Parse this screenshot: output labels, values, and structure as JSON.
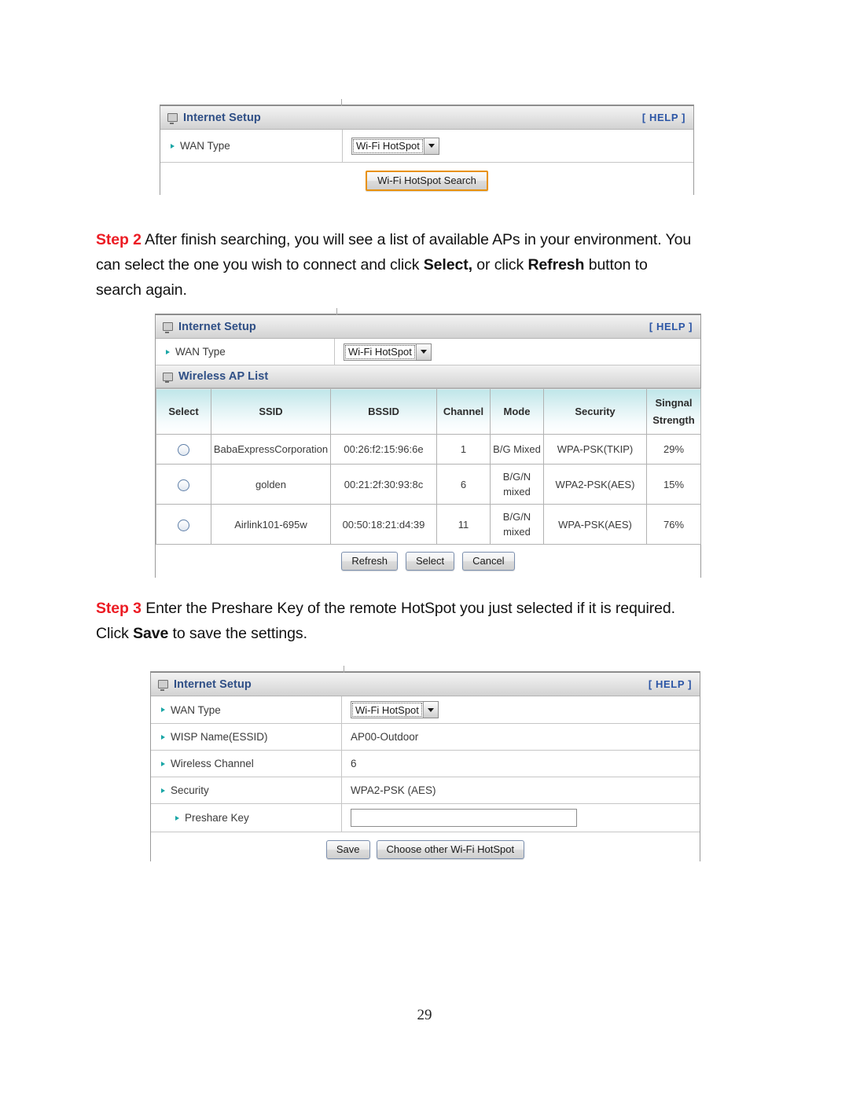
{
  "page": {
    "number": "29"
  },
  "panel1": {
    "header": {
      "title": "Internet Setup",
      "help": "[ HELP ]",
      "icon": "monitor-icon"
    },
    "wan_type": {
      "label": "WAN Type",
      "value": "Wi-Fi HotSpot"
    },
    "search_button": "Wi-Fi HotSpot Search"
  },
  "step2": {
    "tag": "Step 2",
    "line1_a": " After finish searching, you will see a list of available APs in your environment. You",
    "line2_a": "can select the one you wish to connect and click ",
    "line2_b": "Select,",
    "line2_c": " or click ",
    "line2_d": "Refresh",
    "line2_e": " button to",
    "line3": "search again."
  },
  "panel2": {
    "header": {
      "title": "Internet Setup",
      "help": "[ HELP ]",
      "icon": "monitor-icon"
    },
    "wan_type": {
      "label": "WAN Type",
      "value": "Wi-Fi HotSpot"
    },
    "aplist_header": {
      "title": "Wireless AP List",
      "icon": "monitor-icon"
    },
    "columns": [
      "Select",
      "SSID",
      "BSSID",
      "Channel",
      "Mode",
      "Security",
      "Singnal",
      "Strength"
    ],
    "column_signal_line1": "Singnal",
    "column_signal_line2": "Strength",
    "rows": [
      {
        "ssid": "BabaExpressCorporation",
        "bssid": "00:26:f2:15:96:6e",
        "channel": "1",
        "mode": "B/G Mixed",
        "security": "WPA-PSK(TKIP)",
        "signal": "29%"
      },
      {
        "ssid": "golden",
        "bssid": "00:21:2f:30:93:8c",
        "channel": "6",
        "mode": "B/G/N\nmixed",
        "mode_line1": "B/G/N",
        "mode_line2": "mixed",
        "security": "WPA2-PSK(AES)",
        "signal": "15%"
      },
      {
        "ssid": "Airlink101-695w",
        "bssid": "00:50:18:21:d4:39",
        "channel": "11",
        "mode": "B/G/N\nmixed",
        "mode_line1": "B/G/N",
        "mode_line2": "mixed",
        "security": "WPA-PSK(AES)",
        "signal": "76%"
      }
    ],
    "buttons": {
      "refresh": "Refresh",
      "select": "Select",
      "cancel": "Cancel"
    }
  },
  "step3": {
    "tag": "Step 3",
    "line1": " Enter the Preshare Key of the remote HotSpot you just selected if it is required.",
    "line2_a": "Click ",
    "line2_b": "Save",
    "line2_c": " to save the settings."
  },
  "panel3": {
    "header": {
      "title": "Internet Setup",
      "help": "[ HELP ]",
      "icon": "monitor-icon"
    },
    "rows": [
      {
        "label": "WAN Type",
        "value": "Wi-Fi HotSpot",
        "type": "select"
      },
      {
        "label": "WISP Name(ESSID)",
        "value": "AP00-Outdoor",
        "type": "text"
      },
      {
        "label": "Wireless Channel",
        "value": "6",
        "type": "text"
      },
      {
        "label": "Security",
        "value": "WPA2-PSK (AES)",
        "type": "text"
      },
      {
        "label": "Preshare Key",
        "value": "",
        "type": "input",
        "indent": true
      }
    ],
    "buttons": {
      "save": "Save",
      "choose_other": "Choose other Wi-Fi HotSpot"
    }
  },
  "colors": {
    "step_tag": "#ec1c24",
    "panel_header_title": "#2f4f86",
    "help_link": "#2b55a5",
    "arrow_bullet": "#1aa6a6",
    "table_header_cyan": "#bfe6e9",
    "accent_button_border": "#e8910d"
  }
}
